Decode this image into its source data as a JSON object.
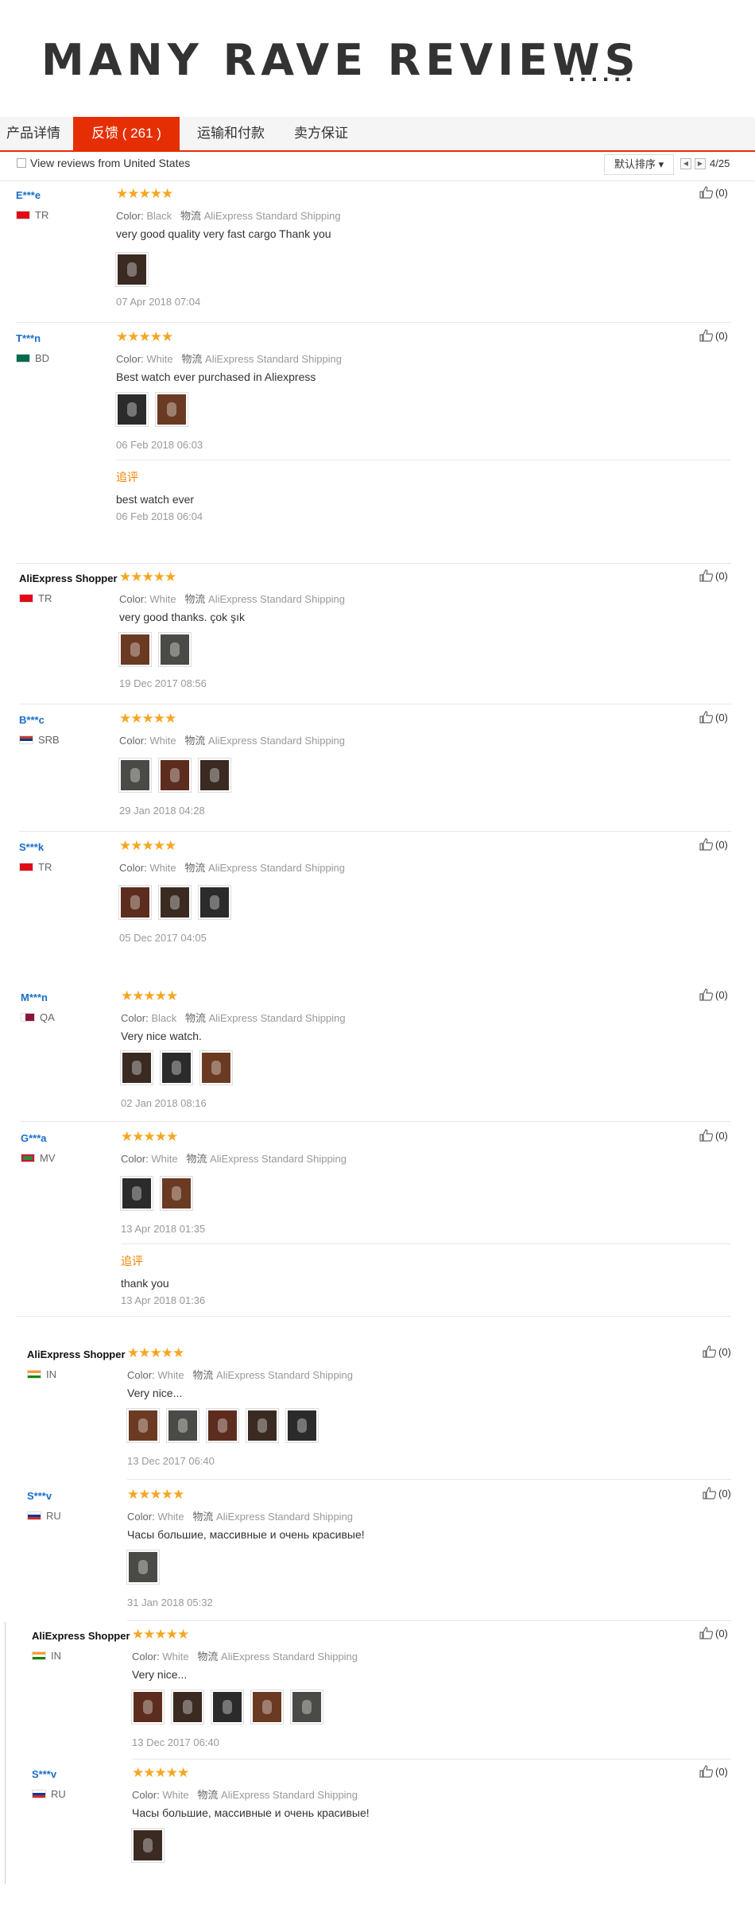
{
  "headline": "MANY RAVE REVIEWS",
  "headline_dots": "......",
  "tabs": [
    {
      "label": "产品详情"
    },
    {
      "label": "反馈 ( 261 )"
    },
    {
      "label": "运输和付款"
    },
    {
      "label": "卖方保证"
    }
  ],
  "filter": {
    "view_label": "View reviews from United States",
    "sort_label": "默认排序",
    "page_text": "4/25"
  },
  "labels": {
    "color_label": "Color:",
    "shipping_label": "物流",
    "followup_label": "追评",
    "like_count": "(0)"
  },
  "colors": {
    "accent": "#e62e04",
    "star": "#f5a623",
    "followup": "#f08200",
    "username": "#1a6ec8"
  },
  "reviews": [
    {
      "user": "E***e",
      "country": "TR",
      "color": "Black",
      "shipping": "AliExpress Standard Shipping",
      "text": "very good quality very fast cargo Thank you",
      "date": "07 Apr 2018 07:04",
      "photos": 1
    },
    {
      "user": "T***n",
      "country": "BD",
      "color": "White",
      "shipping": "AliExpress Standard Shipping",
      "text": "Best watch ever purchased in Aliexpress",
      "date": "06 Feb 2018 06:03",
      "photos": 2,
      "followup_text": "best watch ever",
      "followup_date": "06 Feb 2018 06:04"
    },
    {
      "user": "AliExpress Shopper",
      "country": "TR",
      "color": "White",
      "shipping": "AliExpress Standard Shipping",
      "text": "very good thanks. çok şık",
      "date": "19 Dec 2017 08:56",
      "photos": 2
    },
    {
      "user": "B***c",
      "country": "SRB",
      "color": "White",
      "shipping": "AliExpress Standard Shipping",
      "text": "",
      "date": "29 Jan 2018 04:28",
      "photos": 3
    },
    {
      "user": "S***k",
      "country": "TR",
      "color": "White",
      "shipping": "AliExpress Standard Shipping",
      "text": "",
      "date": "05 Dec 2017 04:05",
      "photos": 3
    },
    {
      "user": "M***n",
      "country": "QA",
      "color": "Black",
      "shipping": "AliExpress Standard Shipping",
      "text": "Very nice watch.",
      "date": "02 Jan 2018 08:16",
      "photos": 3
    },
    {
      "user": "G***a",
      "country": "MV",
      "color": "White",
      "shipping": "AliExpress Standard Shipping",
      "text": "",
      "date": "13 Apr 2018 01:35",
      "photos": 2,
      "followup_text": "thank you",
      "followup_date": "13 Apr 2018 01:36"
    },
    {
      "user": "AliExpress Shopper",
      "country": "IN",
      "color": "White",
      "shipping": "AliExpress Standard Shipping",
      "text": "Very nice...",
      "date": "13 Dec 2017 06:40",
      "photos": 5
    },
    {
      "user": "S***v",
      "country": "RU",
      "color": "White",
      "shipping": "AliExpress Standard Shipping",
      "text": "Часы большие, массивные и очень красивые!",
      "date": "31 Jan 2018 05:32",
      "photos": 1
    },
    {
      "user": "AliExpress Shopper",
      "country": "IN",
      "color": "White",
      "shipping": "AliExpress Standard Shipping",
      "text": "Very nice...",
      "date": "13 Dec 2017 06:40",
      "photos": 5
    },
    {
      "user": "S***v",
      "country": "RU",
      "color": "White",
      "shipping": "AliExpress Standard Shipping",
      "text": "Часы большие, массивные и очень красивые!",
      "date": "",
      "photos": 1
    }
  ]
}
